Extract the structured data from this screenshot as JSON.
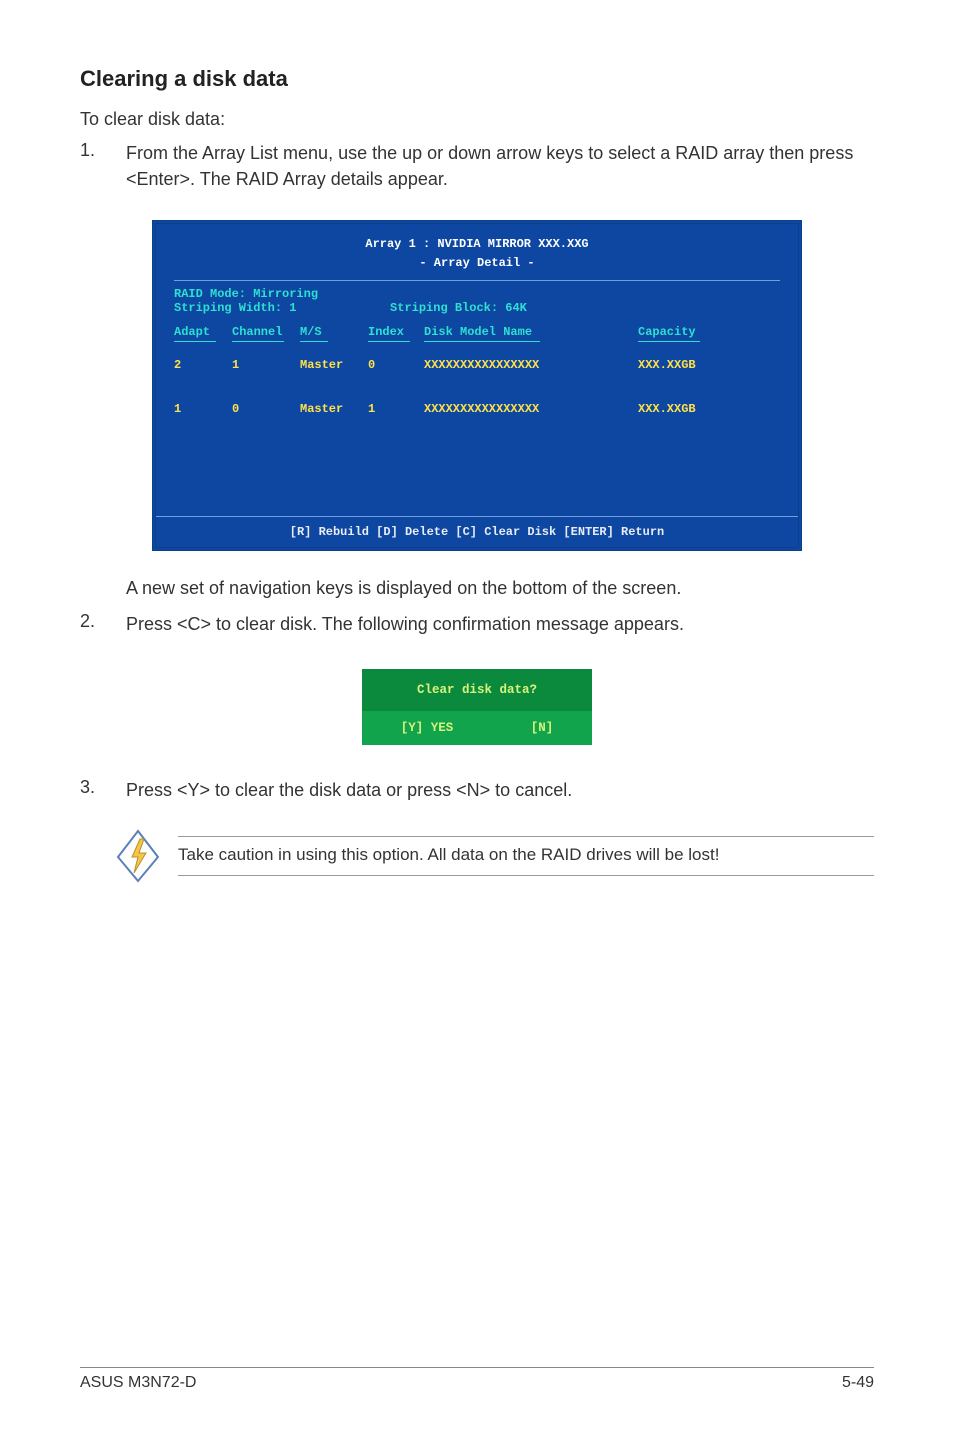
{
  "heading": "Clearing a disk data",
  "intro": "To clear disk data:",
  "steps": {
    "s1_num": "1.",
    "s1_text": "From the Array List menu, use the up or down arrow keys to select a RAID array then press <Enter>. The RAID Array details appear.",
    "nav_line": "A new set of  navigation keys is displayed on the bottom of the screen.",
    "s2_num": "2.",
    "s2_text": "Press <C> to clear disk. The following confirmation message appears.",
    "s3_num": "3.",
    "s3_text": "Press <Y> to clear the disk data or press <N> to cancel."
  },
  "terminal": {
    "title_l1": "Array 1 : NVIDIA MIRROR  XXX.XXG",
    "title_l2": "- Array Detail -",
    "mode": "RAID Mode: Mirroring",
    "width_label": "Striping Width: 1",
    "block_label": "Striping Block: 64K",
    "headers": {
      "adapt": "Adapt",
      "channel": "Channel",
      "ms": "M/S",
      "index": "Index",
      "model": "Disk Model Name",
      "capacity": "Capacity"
    },
    "rows": [
      {
        "adapt": "2",
        "channel": "1",
        "ms": "Master",
        "index": "0",
        "model": "XXXXXXXXXXXXXXXX",
        "capacity": "XXX.XXGB"
      },
      {
        "adapt": "1",
        "channel": "0",
        "ms": "Master",
        "index": "1",
        "model": "XXXXXXXXXXXXXXXX",
        "capacity": "XXX.XXGB"
      }
    ],
    "footer": "[R] Rebuild  [D] Delete  [C] Clear Disk  [ENTER] Return"
  },
  "dialog": {
    "question": "Clear disk data?",
    "yes": "[Y] YES",
    "no": "[N]"
  },
  "note": "Take caution in using this option. All data on the RAID drives will be lost!",
  "footer": {
    "left": "ASUS M3N72-D",
    "right": "5-49"
  }
}
